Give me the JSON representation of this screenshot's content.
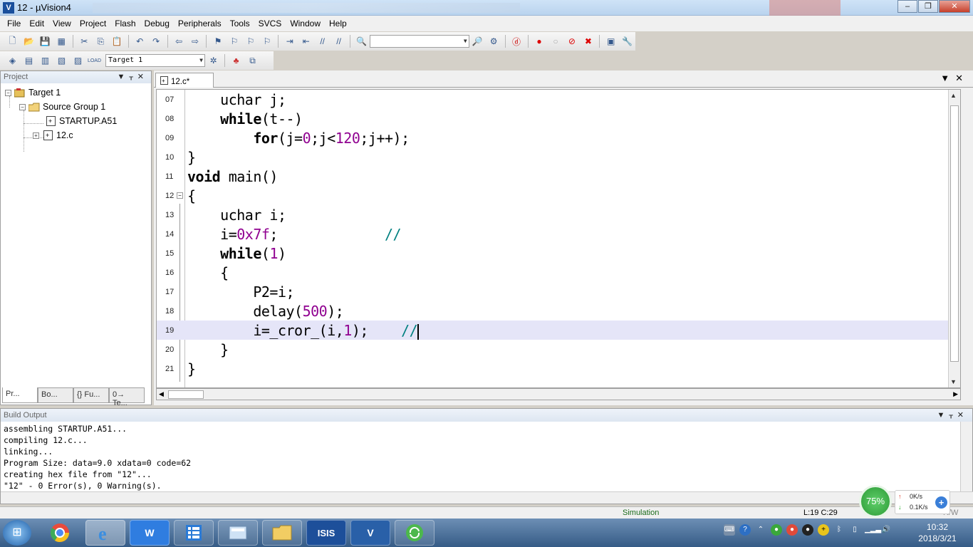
{
  "window": {
    "title": "12  - µVision4",
    "app_icon": "uvision-logo-icon"
  },
  "menu": [
    "File",
    "Edit",
    "View",
    "Project",
    "Flash",
    "Debug",
    "Peripherals",
    "Tools",
    "SVCS",
    "Window",
    "Help"
  ],
  "toolbar2": {
    "target_combo": "Target 1"
  },
  "project_panel": {
    "title": "Project",
    "tree": {
      "target": "Target 1",
      "group": "Source Group 1",
      "files": [
        "STARTUP.A51",
        "12.c"
      ]
    },
    "tabs": [
      "Pr...",
      "Bo...",
      "{} Fu...",
      "0→ Te..."
    ]
  },
  "editor": {
    "tab": "12.c*",
    "lines": [
      {
        "num": "07",
        "code": "    uchar j;"
      },
      {
        "num": "08",
        "code": "    while(t--)"
      },
      {
        "num": "09",
        "code": "        for(j=0;j<120;j++);"
      },
      {
        "num": "10",
        "code": "}"
      },
      {
        "num": "11",
        "code": "void main()"
      },
      {
        "num": "12",
        "code": "{"
      },
      {
        "num": "13",
        "code": "    uchar i;"
      },
      {
        "num": "14",
        "code": "    i=0x7f;             //"
      },
      {
        "num": "15",
        "code": "    while(1)"
      },
      {
        "num": "16",
        "code": "    {"
      },
      {
        "num": "17",
        "code": "        P2=i;"
      },
      {
        "num": "18",
        "code": "        delay(500);"
      },
      {
        "num": "19",
        "code": "        i=_cror_(i,1);    //"
      },
      {
        "num": "20",
        "code": "    }"
      },
      {
        "num": "21",
        "code": "}"
      }
    ]
  },
  "build_output": {
    "title": "Build Output",
    "lines": [
      "assembling STARTUP.A51...",
      "compiling 12.c...",
      "linking...",
      "Program Size: data=9.0 xdata=0 code=62",
      "creating hex file from \"12\"...",
      "\"12\" - 0 Error(s), 0 Warning(s)."
    ]
  },
  "status": {
    "mode": "Simulation",
    "position": "L:19 C:29",
    "rw": "R/W"
  },
  "net_widget": {
    "percent": "75%",
    "upload": "0K/s",
    "download": "0.1K/s"
  },
  "taskbar": {
    "apps": [
      "chrome-icon",
      "ie-icon",
      "wps-icon",
      "grid-icon",
      "calculator-icon",
      "folder-icon",
      "isis-icon",
      "uvision-icon",
      "refresh-icon"
    ],
    "time": "10:32",
    "date": "2018/3/21"
  }
}
